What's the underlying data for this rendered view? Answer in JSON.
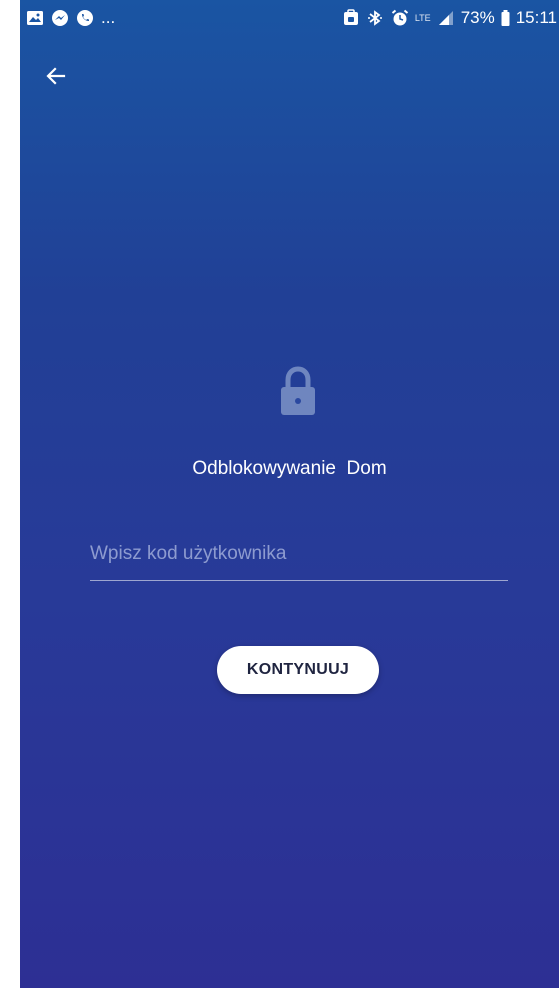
{
  "status_bar": {
    "left_icons": [
      "gallery-icon",
      "messenger-icon",
      "phone-icon"
    ],
    "more_indicator": "...",
    "right_icons": [
      "nfc-icon",
      "bluetooth-icon",
      "alarm-icon",
      "lte-icon",
      "signal-icon"
    ],
    "lte_label": "LTE",
    "battery_percent": "73%",
    "time": "15:11"
  },
  "header": {
    "back_icon": "arrow-left-icon"
  },
  "main": {
    "lock_icon": "lock-icon",
    "title": "Odblokowywanie  Dom",
    "code_input": {
      "value": "",
      "placeholder": "Wpisz kod użytkownika"
    },
    "continue_label": "KONTYNUUJ"
  },
  "colors": {
    "gradient_top": "#1a55a3",
    "gradient_bottom": "#2d2f94",
    "button_bg": "#ffffff",
    "button_text": "#1f2440",
    "lock_icon": "#6f86bf"
  }
}
